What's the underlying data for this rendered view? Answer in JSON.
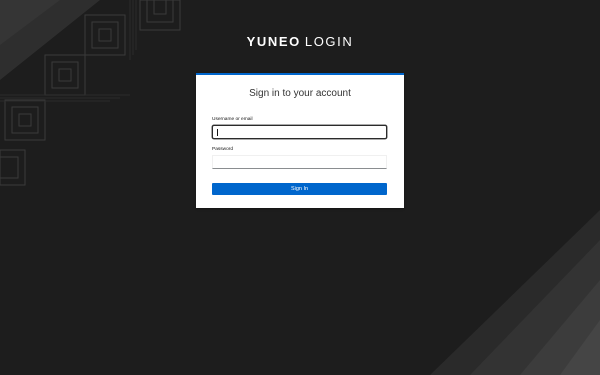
{
  "header": {
    "brand_strong": "YUNEO",
    "brand_light": "LOGIN"
  },
  "login_card": {
    "title": "Sign in to your account",
    "username": {
      "label": "Username or email",
      "value": "",
      "placeholder": ""
    },
    "password": {
      "label": "Password",
      "value": "",
      "placeholder": ""
    },
    "submit_label": "Sign In"
  },
  "colors": {
    "background": "#1d1d1d",
    "accent": "#0066cc",
    "card": "#ffffff"
  }
}
